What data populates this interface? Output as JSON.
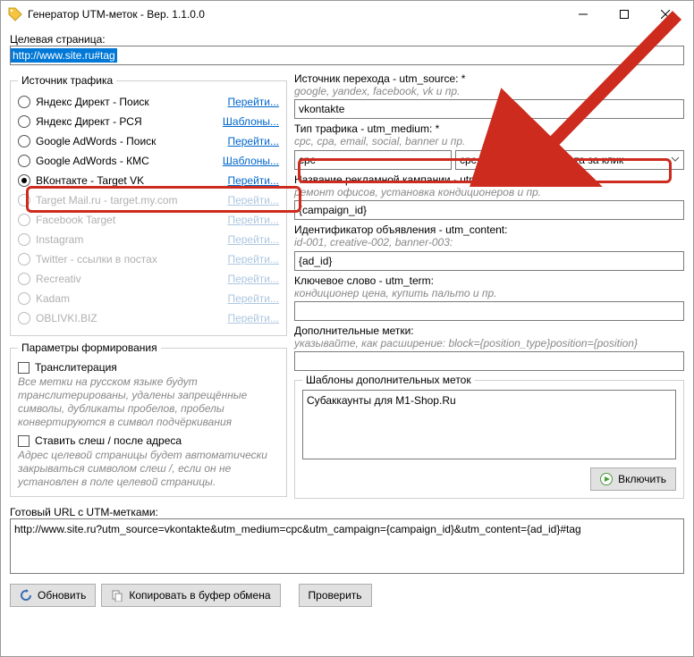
{
  "window": {
    "title": "Генератор UTM-меток - Вер. 1.1.0.0"
  },
  "target_page": {
    "label": "Целевая страница:",
    "value": "http://www.site.ru#tag"
  },
  "traffic_source": {
    "legend": "Источник трафика",
    "items": [
      {
        "id": "yd-search",
        "label": "Яндекс Директ - Поиск",
        "link": "Перейти...",
        "checked": false,
        "enabled": true
      },
      {
        "id": "yd-rsya",
        "label": "Яндекс Директ - РСЯ",
        "link": "Шаблоны...",
        "checked": false,
        "enabled": true
      },
      {
        "id": "ga-search",
        "label": "Google AdWords - Поиск",
        "link": "Перейти...",
        "checked": false,
        "enabled": true
      },
      {
        "id": "ga-kmc",
        "label": "Google AdWords - КМС",
        "link": "Шаблоны...",
        "checked": false,
        "enabled": true
      },
      {
        "id": "vk",
        "label": "ВКонтакте - Target VK",
        "link": "Перейти...",
        "checked": true,
        "enabled": true
      },
      {
        "id": "mailru",
        "label": "Target Mail.ru - target.my.com",
        "link": "Перейти...",
        "checked": false,
        "enabled": false
      },
      {
        "id": "fb",
        "label": "Facebook Target",
        "link": "Перейти...",
        "checked": false,
        "enabled": false
      },
      {
        "id": "ig",
        "label": "Instagram",
        "link": "Перейти...",
        "checked": false,
        "enabled": false
      },
      {
        "id": "tw",
        "label": "Twitter - ссылки в постах",
        "link": "Перейти...",
        "checked": false,
        "enabled": false
      },
      {
        "id": "recreativ",
        "label": "Recreativ",
        "link": "Перейти...",
        "checked": false,
        "enabled": false
      },
      {
        "id": "kadam",
        "label": "Kadam",
        "link": "Перейти...",
        "checked": false,
        "enabled": false
      },
      {
        "id": "oblivki",
        "label": "OBLIVKI.BIZ",
        "link": "Перейти...",
        "checked": false,
        "enabled": false
      }
    ]
  },
  "params": {
    "legend": "Параметры формирования",
    "transliteration_label": "Транслитерация",
    "transliteration_hint": "Все метки на русском языке будут транслитерированы, удалены запрещённые символы, дубликаты пробелов, пробелы конвертируются в символ подчёркивания",
    "slash_label": "Ставить слеш / после адреса",
    "slash_hint": "Адрес целевой страницы будет автоматически закрываться символом слеш /, если он не установлен в поле целевой страницы."
  },
  "right": {
    "source": {
      "label": "Источник перехода - utm_source: *",
      "hint": "google, yandex, facebook, vk и пр.",
      "value": "vkontakte"
    },
    "medium": {
      "label": "Тип трафика - utm_medium: *",
      "hint": "cpc, cpa, email, social, banner и пр.",
      "value": "cpc",
      "select_value": "cpc – cost per click, плата за клик"
    },
    "campaign": {
      "label": "Название рекламной кампании - utm_campaign: *",
      "hint": "ремонт офисов, установка кондиционеров и пр.",
      "value": "{campaign_id}"
    },
    "content": {
      "label": "Идентификатор объявления - utm_content:",
      "hint": "id-001, creative-002, banner-003:",
      "value": "{ad_id}"
    },
    "term": {
      "label": "Ключевое слово - utm_term:",
      "hint": "кондиционер цена, купить пальто и пр.",
      "value": ""
    },
    "extra": {
      "label": "Дополнительные метки:",
      "hint": "указывайте, как расширение: block={position_type}position={position}",
      "value": ""
    },
    "templates": {
      "legend": "Шаблоны дополнительных меток",
      "value": "Субаккаунты для M1-Shop.Ru",
      "enable_btn": "Включить"
    }
  },
  "result": {
    "label": "Готовый URL с UTM-метками:",
    "value": "http://www.site.ru?utm_source=vkontakte&utm_medium=cpc&utm_campaign={campaign_id}&utm_content={ad_id}#tag"
  },
  "buttons": {
    "refresh": "Обновить",
    "copy": "Копировать в буфер обмена",
    "check": "Проверить"
  }
}
